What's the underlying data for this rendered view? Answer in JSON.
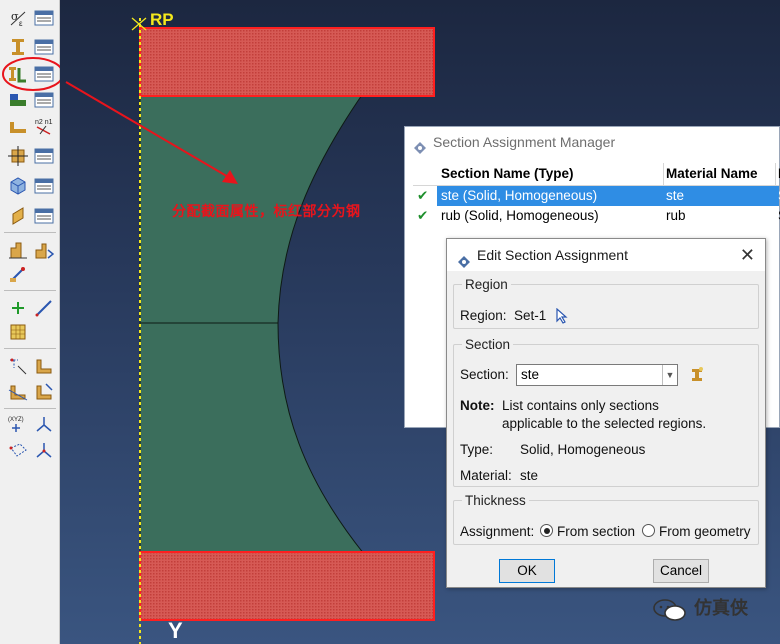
{
  "toolbox": {
    "buttons": [
      "create-material-icon",
      "material-manager-icon",
      "create-section-icon",
      "section-manager-icon",
      "assign-section-icon",
      "section-assignment-manager-icon",
      "create-profile-icon",
      "profile-manager-icon",
      "assign-beam-orientation-icon",
      "assign-ref-node-icon",
      "create-composite-layup-icon",
      "composite-manager-icon",
      "assign-material-orientation-icon",
      "material-orientation-manager-icon",
      "assign-shell-offset-icon",
      "shell-offset-manager-icon",
      "special-skin-icon",
      "special-stringer-icon",
      "inertia-icon",
      "datum-point-icon",
      "datum-axis-icon",
      "datum-plane-icon",
      "partition-face-icon",
      "partition-cell-icon",
      "create-partition-icon",
      "csys-icon",
      "view-direction-icon",
      "query-point-icon",
      "query-node-icon"
    ]
  },
  "viewport": {
    "rp_label": "RP",
    "y_label": "Y",
    "annotation": "分配截面属性，标红部分为钢",
    "colors": {
      "part": "#3b6e5c",
      "steel_highlight": "#e83232",
      "axis": "#f4e81c",
      "annotation": "#e8141c"
    }
  },
  "manager": {
    "title": "Section Assignment Manager",
    "col_section": "Section Name (Type)",
    "col_material": "Material Name",
    "col_extra": "I",
    "rows": [
      {
        "section": "ste (Solid, Homogeneous)",
        "material": "ste",
        "extra": "S",
        "selected": true
      },
      {
        "section": "rub (Solid, Homogeneous)",
        "material": "rub",
        "extra": "S",
        "selected": false
      }
    ]
  },
  "edit": {
    "title": "Edit Section Assignment",
    "close": "✕",
    "region_group": "Region",
    "region_label": "Region:",
    "region_value": "Set-1",
    "section_group": "Section",
    "section_label": "Section:",
    "section_value": "ste",
    "note_label": "Note:",
    "note_line1": "List contains only sections",
    "note_line2": "applicable to the selected regions.",
    "type_label": "Type:",
    "type_value": "Solid, Homogeneous",
    "material_label": "Material:",
    "material_value": "ste",
    "thickness_group": "Thickness",
    "assignment_label": "Assignment:",
    "opt_from_section": "From section",
    "opt_from_geometry": "From geometry",
    "selected_option": "From section",
    "ok": "OK",
    "cancel": "Cancel"
  },
  "watermark": {
    "text": "仿真侠"
  }
}
